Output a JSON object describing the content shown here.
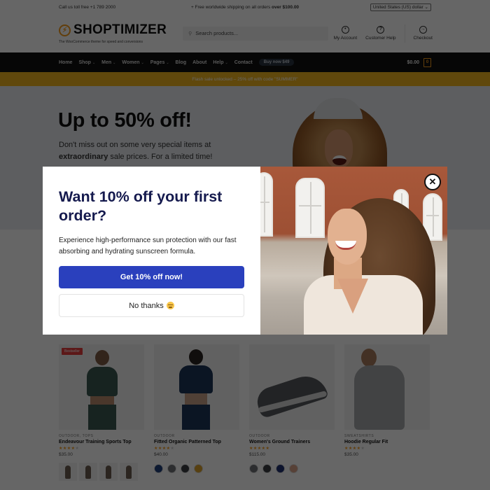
{
  "topbar": {
    "call": "Call us toll free +1 789 2000",
    "shipping_prefix": "+ Free worldwide shipping on all orders ",
    "shipping_bold": "over $100.00",
    "currency": "United States (US) dollar"
  },
  "header": {
    "logo_text": "SHOPTIMIZER",
    "logo_icon": "lightning-bolt-icon",
    "tagline": "The WooCommerce theme for speed and conversions",
    "search_placeholder": "Search products...",
    "links": [
      {
        "label": "My Account",
        "icon": "user-circle-icon"
      },
      {
        "label": "Customer Help",
        "icon": "help-circle-icon"
      },
      {
        "label": "Checkout",
        "icon": "arrow-right-circle-icon"
      }
    ]
  },
  "nav": {
    "items": [
      {
        "label": "Home",
        "dropdown": false
      },
      {
        "label": "Shop",
        "dropdown": true
      },
      {
        "label": "Men",
        "dropdown": true
      },
      {
        "label": "Women",
        "dropdown": true
      },
      {
        "label": "Pages",
        "dropdown": true
      },
      {
        "label": "Blog",
        "dropdown": false
      },
      {
        "label": "About",
        "dropdown": false
      },
      {
        "label": "Help",
        "dropdown": true
      },
      {
        "label": "Contact",
        "dropdown": false
      }
    ],
    "buy_label": "Buy now $49",
    "cart_total": "$0.00",
    "cart_count": "0"
  },
  "promo_bar": "Flash sale unlocked – 25% off with code \"SUMMER\"",
  "hero": {
    "title": "Up to 50% off!",
    "text_before": "Don't miss out on some very special items at ",
    "text_bold": "extraordinary",
    "text_after": " sale prices. For a limited time!"
  },
  "products": [
    {
      "badge": "Bestseller",
      "category": "Outdoor, Tops",
      "name": "Endeavour Training Sports Top",
      "rating": 4,
      "price": "$35.00",
      "thumbnails": 4,
      "swatches": []
    },
    {
      "badge": "",
      "category": "Outdoor",
      "name": "Fitted Organic Patterned Top",
      "rating": 4,
      "price": "$40.00",
      "thumbnails": 0,
      "swatches": [
        "#1f3f7a",
        "#6e7275",
        "#3a3d42",
        "#d9a12c"
      ]
    },
    {
      "badge": "",
      "category": "Outdoor",
      "name": "Women's Ground Trainers",
      "rating": 5,
      "price": "$115.00",
      "thumbnails": 0,
      "swatches": [
        "#6e7275",
        "#3a3d42",
        "#1f3070",
        "#d9a48a"
      ]
    },
    {
      "badge": "",
      "category": "Sweatshirts",
      "name": "Hoodie Regular Fit",
      "rating": 4,
      "price": "$35.00",
      "thumbnails": 0,
      "swatches": []
    }
  ],
  "modal": {
    "title": "Want 10% off your first order?",
    "description": "Experience high-performance sun protection with our fast absorbing and hydrating sunscreen formula.",
    "primary_button": "Get 10% off now!",
    "secondary_button": "No thanks",
    "secondary_emoji": "pensive-face-emoji",
    "close_icon": "close-icon",
    "colors": {
      "title": "#151a4e",
      "primary_button": "#2a40bd"
    }
  },
  "colors": {
    "accent": "#f49b1c",
    "promo_bar": "#f0b31f",
    "nav_bg": "#111111",
    "badge": "#e53e3e"
  }
}
